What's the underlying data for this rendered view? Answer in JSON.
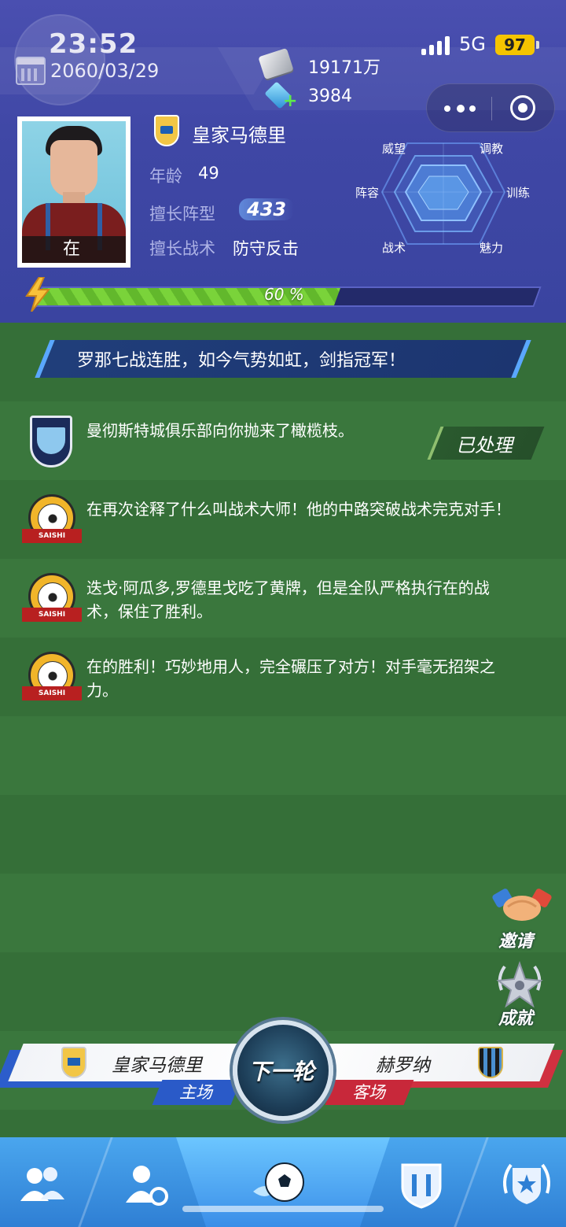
{
  "status_bar": {
    "time": "23:52",
    "network": "5G",
    "battery": "97"
  },
  "header": {
    "date": "2060/03/29",
    "money": "19171万",
    "gems": "3984"
  },
  "manager": {
    "portrait_label": "在",
    "club": "皇家马德里",
    "age_label": "年龄",
    "age": "49",
    "formation_label": "擅长阵型",
    "formation": "433",
    "tactic_label": "擅长战术",
    "tactic": "防守反击"
  },
  "radar": {
    "labels": [
      "威望",
      "调教",
      "阵容",
      "训练",
      "战术",
      "魅力"
    ]
  },
  "progress": {
    "percent": 60,
    "text": "60 %"
  },
  "headline": "罗那七战连胜，如今气势如虹，剑指冠军！",
  "news": [
    {
      "icon": "club-shield-icon",
      "text": "曼彻斯特城俱乐部向你抛来了橄榄枝。",
      "action": "已处理"
    },
    {
      "icon": "saishi-icon",
      "badge": "SAISHI",
      "text": "在再次诠释了什么叫战术大师！他的中路突破战术完克对手！"
    },
    {
      "icon": "saishi-icon",
      "badge": "SAISHI",
      "text": "迭戈·阿瓜多,罗德里戈吃了黄牌，但是全队严格执行在的战术，保住了胜利。"
    },
    {
      "icon": "saishi-icon",
      "badge": "SAISHI",
      "text": "在的胜利！巧妙地用人，完全碾压了对方！对手毫无招架之力。"
    }
  ],
  "side_buttons": {
    "invite": "邀请",
    "achievements": "成就"
  },
  "match": {
    "home_team": "皇家马德里",
    "home_label": "主场",
    "away_team": "赫罗纳",
    "away_label": "客场",
    "next_round": "下一轮"
  },
  "bottom_nav": [
    "team-icon",
    "transfer-icon",
    "match-icon",
    "club-icon",
    "honors-icon"
  ],
  "colors": {
    "header_bg": "#3f47a5",
    "field_green": "#356f38",
    "progress_green": "#7ad33a",
    "home_blue": "#2a5ac8",
    "away_red": "#c8283a",
    "battery_yellow": "#f5c400"
  }
}
